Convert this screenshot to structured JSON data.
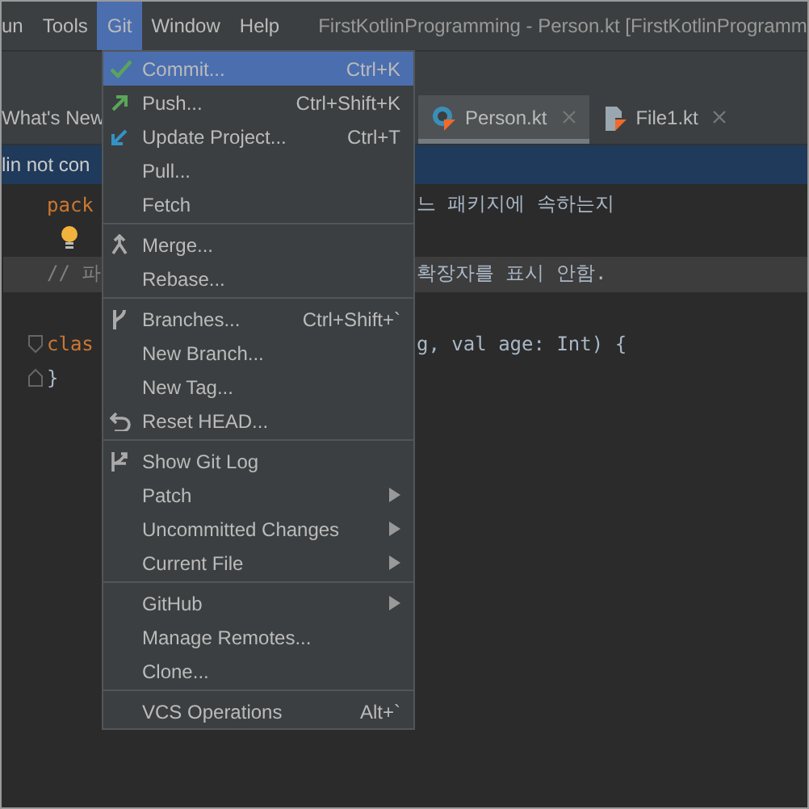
{
  "menubar": {
    "items": [
      {
        "label": "un",
        "selected": false
      },
      {
        "label": "Tools",
        "selected": false
      },
      {
        "label": "Git",
        "selected": true
      },
      {
        "label": "Window",
        "selected": false
      },
      {
        "label": "Help",
        "selected": false
      }
    ],
    "title": "FirstKotlinProgramming - Person.kt [FirstKotlinProgramm"
  },
  "tabs": [
    {
      "label": "What's New",
      "selected": false,
      "kind": "plain"
    },
    {
      "label": "Person.kt",
      "selected": true,
      "kind": "class"
    },
    {
      "label": "File1.kt",
      "selected": false,
      "kind": "file"
    }
  ],
  "banner": "lin not con",
  "editor": {
    "lines": [
      {
        "kind": "package",
        "left": "pack",
        "right": "느 패키지에 속하는지",
        "highlighted": false
      },
      {
        "kind": "bulb",
        "highlighted": false
      },
      {
        "kind": "comment",
        "left": "// 파",
        "right": "확장자를 표시 안함.",
        "highlighted": true
      },
      {
        "kind": "blank",
        "highlighted": false
      },
      {
        "kind": "class",
        "left": "clas",
        "right": "g, val age: Int) {",
        "highlighted": false
      },
      {
        "kind": "close",
        "left": "}",
        "highlighted": false
      }
    ]
  },
  "menu": {
    "groups": [
      [
        {
          "label": "Commit...",
          "shortcut": "Ctrl+K",
          "kind": "check",
          "submenu": false,
          "selected": true
        },
        {
          "label": "Push...",
          "shortcut": "Ctrl+Shift+K",
          "kind": "push",
          "submenu": false,
          "selected": false
        },
        {
          "label": "Update Project...",
          "shortcut": "Ctrl+T",
          "kind": "update",
          "submenu": false,
          "selected": false
        },
        {
          "label": "Pull...",
          "kind": "plain",
          "submenu": false,
          "selected": false
        },
        {
          "label": "Fetch",
          "kind": "plain",
          "submenu": false,
          "selected": false
        }
      ],
      [
        {
          "label": "Merge...",
          "kind": "merge",
          "submenu": false,
          "selected": false
        },
        {
          "label": "Rebase...",
          "kind": "plain",
          "submenu": false,
          "selected": false
        }
      ],
      [
        {
          "label": "Branches...",
          "shortcut": "Ctrl+Shift+`",
          "kind": "branch",
          "submenu": false,
          "selected": false
        },
        {
          "label": "New Branch...",
          "kind": "plain",
          "submenu": false,
          "selected": false
        },
        {
          "label": "New Tag...",
          "kind": "plain",
          "submenu": false,
          "selected": false
        },
        {
          "label": "Reset HEAD...",
          "kind": "reset",
          "submenu": false,
          "selected": false
        }
      ],
      [
        {
          "label": "Show Git Log",
          "kind": "log",
          "submenu": false,
          "selected": false
        },
        {
          "label": "Patch",
          "kind": "plain",
          "submenu": true,
          "selected": false
        },
        {
          "label": "Uncommitted Changes",
          "kind": "plain",
          "submenu": true,
          "selected": false
        },
        {
          "label": "Current File",
          "kind": "plain",
          "submenu": true,
          "selected": false
        }
      ],
      [
        {
          "label": "GitHub",
          "kind": "plain",
          "submenu": true,
          "selected": false
        },
        {
          "label": "Manage Remotes...",
          "kind": "plain",
          "submenu": false,
          "selected": false
        },
        {
          "label": "Clone...",
          "kind": "plain",
          "submenu": false,
          "selected": false
        }
      ],
      [
        {
          "label": "VCS Operations",
          "shortcut": "Alt+`",
          "kind": "plain",
          "submenu": false,
          "selected": false
        }
      ]
    ]
  }
}
